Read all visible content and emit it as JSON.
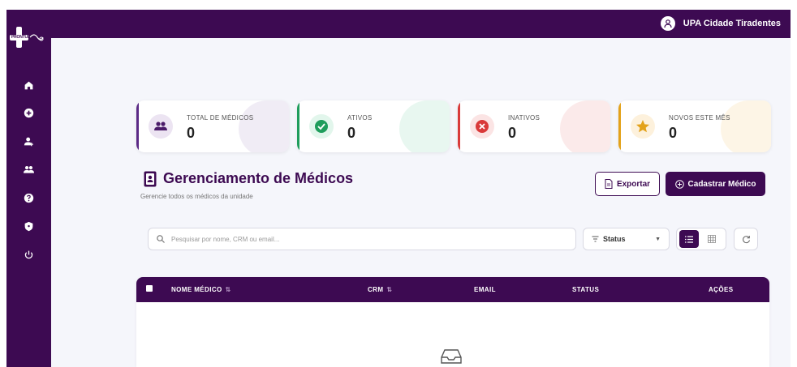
{
  "sidebar": {
    "logo_text": "PRONTUARIO",
    "items": [
      {
        "icon": "home-icon"
      },
      {
        "icon": "plus-circle-icon"
      },
      {
        "icon": "user-medical-icon"
      },
      {
        "icon": "users-icon"
      },
      {
        "icon": "help-icon"
      },
      {
        "icon": "shield-icon"
      },
      {
        "icon": "power-icon"
      }
    ]
  },
  "header": {
    "unit_name": "UPA Cidade Tiradentes"
  },
  "stats": [
    {
      "label": "TOTAL DE MÉDICOS",
      "value": "0",
      "color": "#5b2a86",
      "bg": "#ece4f2"
    },
    {
      "label": "ATIVOS",
      "value": "0",
      "color": "#1f9d5c",
      "bg": "#e2f6ec"
    },
    {
      "label": "INATIVOS",
      "value": "0",
      "color": "#d93a3a",
      "bg": "#fbe4e4"
    },
    {
      "label": "NOVOS ESTE MÊS",
      "value": "0",
      "color": "#e3a21a",
      "bg": "#fdf1dc"
    }
  ],
  "page": {
    "title": "Gerenciamento de Médicos",
    "subtitle": "Gerencie todos os médicos da unidade"
  },
  "actions": {
    "export_label": "Exportar",
    "register_label": "Cadastrar Médico"
  },
  "filters": {
    "search_placeholder": "Pesquisar por nome, CRM ou email...",
    "status_label": "Status"
  },
  "table": {
    "columns": [
      "NOME MÉDICO",
      "CRM",
      "EMAIL",
      "STATUS",
      "AÇÕES"
    ]
  },
  "colors": {
    "brand": "#3d0a52",
    "background": "#f5f6fb"
  }
}
